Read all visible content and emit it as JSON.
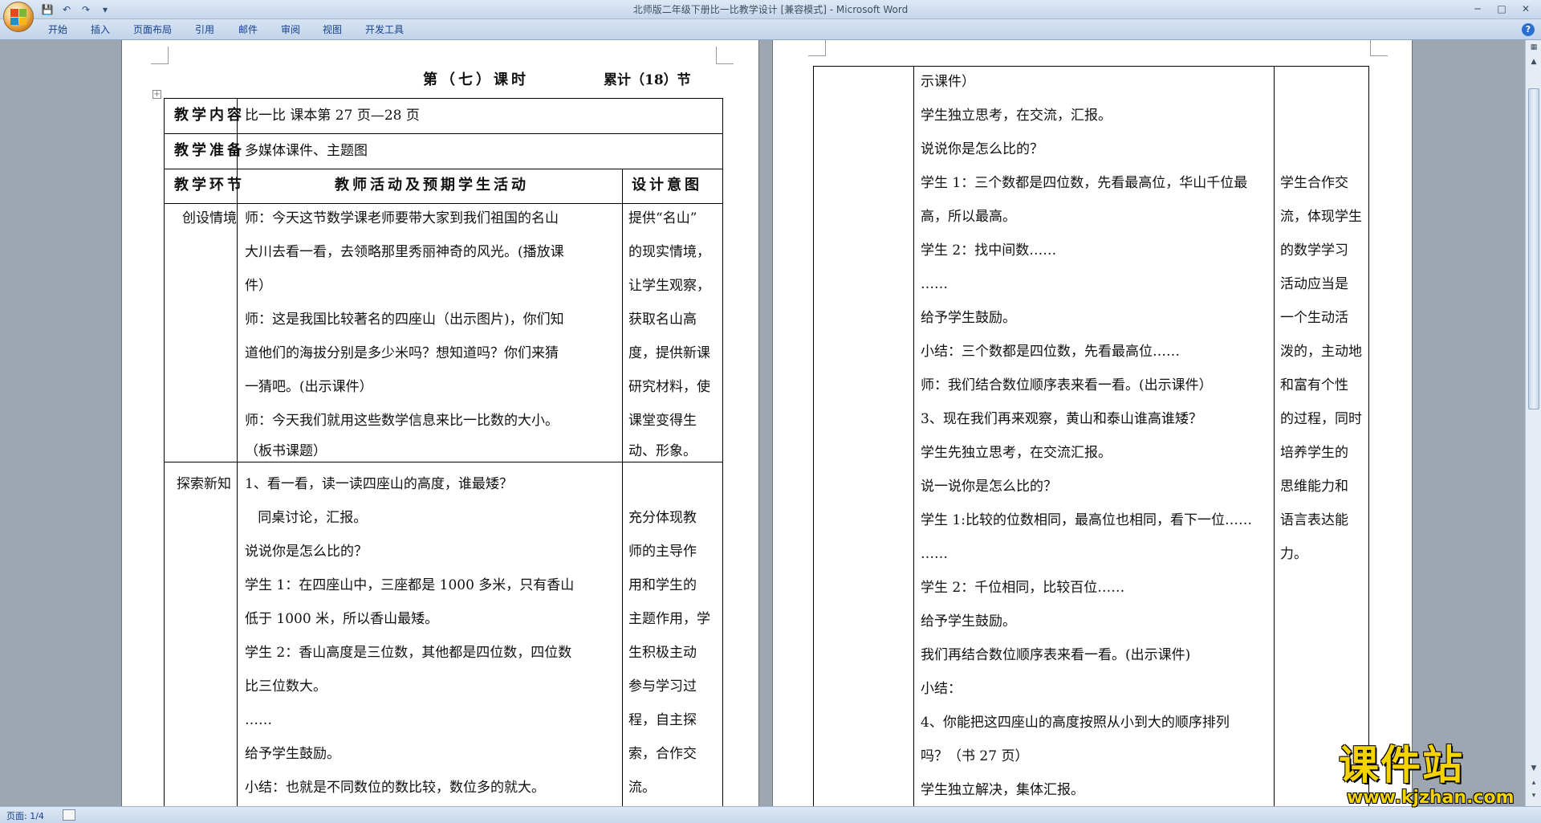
{
  "window": {
    "title": "北师版二年级下册比一比教学设计 [兼容模式] - Microsoft Word",
    "controls": [
      "─",
      "□",
      "✕"
    ]
  },
  "qat": [
    "💾",
    "↶",
    "↷",
    "▾"
  ],
  "ribbon_tabs": [
    "开始",
    "插入",
    "页面布局",
    "引用",
    "邮件",
    "审阅",
    "视图",
    "开发工具"
  ],
  "page1": {
    "heading": "第（七）课时",
    "cumulative": "累计（18）节",
    "row_content_label": "教学内容",
    "row_content_value": "比一比 课本第 27 页—28 页",
    "row_prep_label": "教学准备",
    "row_prep_value": "多媒体课件、主题图",
    "col_stage": "教学环节",
    "col_activity": "教师活动及预期学生活动",
    "col_intent": "设计意图",
    "stage1": "创设情境",
    "stage1_lines": [
      "师：今天这节数学课老师要带大家到我们祖国的名山",
      "大川去看一看，去领略那里秀丽神奇的风光。(播放课",
      "件）",
      "师：这是我国比较著名的四座山（出示图片)，你们知",
      "道他们的海拔分别是多少米吗？想知道吗？你们来猜",
      "一猜吧。(出示课件）",
      "师：今天我们就用这些数学信息来比一比数的大小。",
      "（板书课题）"
    ],
    "intent1_lines": [
      "提供“名山”",
      "的现实情境，",
      "让学生观察，",
      "获取名山高",
      "度，提供新课",
      "研究材料，使",
      "课堂变得生",
      "动、形象。"
    ],
    "stage2": "探索新知",
    "stage2_lines": [
      "1、看一看，读一读四座山的高度，谁最矮？",
      "   同桌讨论，汇报。",
      "说说你是怎么比的？",
      "学生 1：在四座山中，三座都是 1000 多米，只有香山",
      "低于 1000 米，所以香山最矮。",
      "学生 2：香山高度是三位数，其他都是四位数，四位数",
      "比三位数大。",
      "……",
      "给予学生鼓励。",
      "小结：也就是不同数位的数比较，数位多的就大。"
    ],
    "intent2_lines": [
      "",
      "充分体现教",
      "师的主导作",
      "用和学生的",
      "主题作用，学",
      "生积极主动",
      "参与学习过",
      "程，自主探",
      "索，合作交",
      "流。"
    ]
  },
  "page2": {
    "activity_lines": [
      "示课件）",
      "学生独立思考，在交流，汇报。",
      "说说你是怎么比的？",
      "学生 1：三个数都是四位数，先看最高位，华山千位最",
      "高，所以最高。",
      "学生 2：找中间数……",
      "……",
      "给予学生鼓励。",
      "小结：三个数都是四位数，先看最高位……",
      "师：我们结合数位顺序表来看一看。(出示课件）",
      "3、现在我们再来观察，黄山和泰山谁高谁矮？",
      "学生先独立思考，在交流汇报。",
      "说一说你是怎么比的？",
      "学生 1:比较的位数相同，最高位也相同，看下一位……",
      "……",
      "学生 2：千位相同，比较百位……",
      "给予学生鼓励。",
      "我们再结合数位顺序表来看一看。(出示课件)",
      "小结：",
      "4、你能把这四座山的高度按照从小到大的顺序排列",
      "吗？（书 27 页）",
      "学生独立解决，集体汇报。"
    ],
    "intent_lines": [
      "",
      "",
      "",
      "学生合作交",
      "流，体现学生",
      "的数学学习",
      "活动应当是",
      "一个生动活",
      "泼的，主动地",
      "和富有个性",
      "的过程，同时",
      "培养学生的",
      "思维能力和",
      "语言表达能",
      "力。"
    ]
  },
  "status": {
    "page": "页面: 1/4"
  },
  "watermark": {
    "title": "课件站",
    "url": "www.kjzhan.com"
  },
  "colors": {
    "title_bg": "#c5d6ea",
    "tab_text": "#15428b",
    "watermark": "#f4d400"
  }
}
